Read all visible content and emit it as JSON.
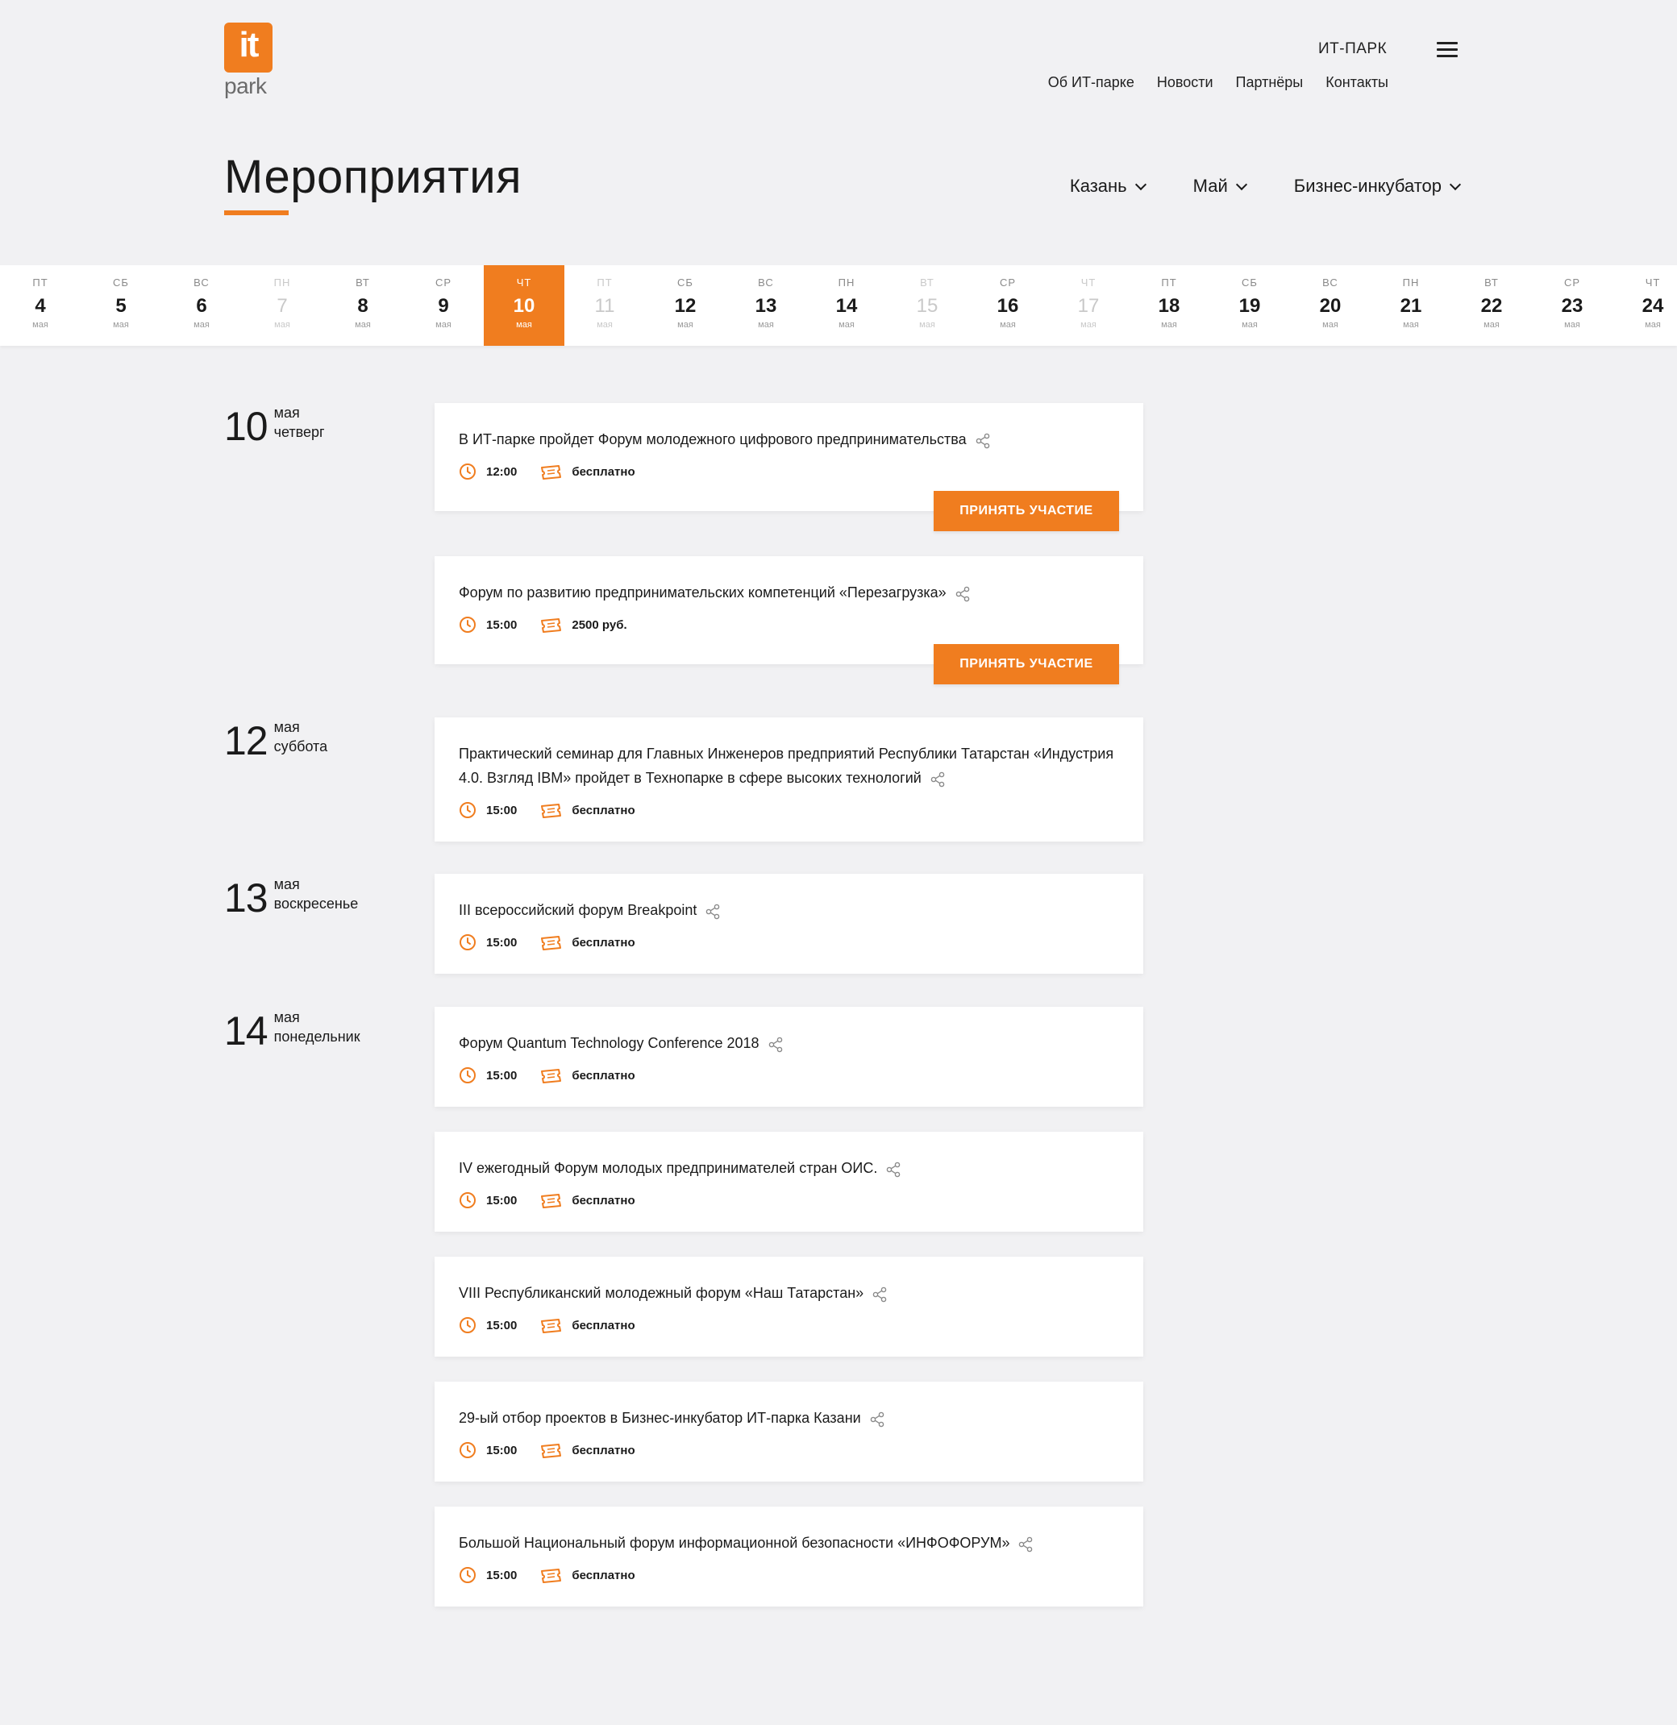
{
  "logo": {
    "mark": "it",
    "sub": "park"
  },
  "brand": "ИТ-ПАРК",
  "nav": [
    "Об ИТ-парке",
    "Новости",
    "Партнёры",
    "Контакты"
  ],
  "page_title": "Мероприятия",
  "filters": {
    "city": "Казань",
    "month": "Май",
    "category": "Бизнес-инкубатор"
  },
  "calendar": [
    {
      "dw": "пт",
      "dn": "4",
      "dm": "мая",
      "muted": false
    },
    {
      "dw": "сб",
      "dn": "5",
      "dm": "мая",
      "muted": false
    },
    {
      "dw": "вс",
      "dn": "6",
      "dm": "мая",
      "muted": false
    },
    {
      "dw": "пн",
      "dn": "7",
      "dm": "мая",
      "muted": true
    },
    {
      "dw": "вт",
      "dn": "8",
      "dm": "мая",
      "muted": false
    },
    {
      "dw": "ср",
      "dn": "9",
      "dm": "мая",
      "muted": false
    },
    {
      "dw": "чт",
      "dn": "10",
      "dm": "мая",
      "muted": false,
      "active": true
    },
    {
      "dw": "пт",
      "dn": "11",
      "dm": "мая",
      "muted": true
    },
    {
      "dw": "сб",
      "dn": "12",
      "dm": "мая",
      "muted": false
    },
    {
      "dw": "вс",
      "dn": "13",
      "dm": "мая",
      "muted": false
    },
    {
      "dw": "пн",
      "dn": "14",
      "dm": "мая",
      "muted": false
    },
    {
      "dw": "вт",
      "dn": "15",
      "dm": "мая",
      "muted": true
    },
    {
      "dw": "ср",
      "dn": "16",
      "dm": "мая",
      "muted": false
    },
    {
      "dw": "чт",
      "dn": "17",
      "dm": "мая",
      "muted": true
    },
    {
      "dw": "пт",
      "dn": "18",
      "dm": "мая",
      "muted": false
    },
    {
      "dw": "сб",
      "dn": "19",
      "dm": "мая",
      "muted": false
    },
    {
      "dw": "вс",
      "dn": "20",
      "dm": "мая",
      "muted": false
    },
    {
      "dw": "пн",
      "dn": "21",
      "dm": "мая",
      "muted": false
    },
    {
      "dw": "вт",
      "dn": "22",
      "dm": "мая",
      "muted": false
    },
    {
      "dw": "ср",
      "dn": "23",
      "dm": "мая",
      "muted": false
    },
    {
      "dw": "чт",
      "dn": "24",
      "dm": "мая",
      "muted": false
    }
  ],
  "date_labels": [
    {
      "num": "10",
      "month": "мая",
      "weekday": "четверг"
    },
    {
      "num": "12",
      "month": "мая",
      "weekday": "суббота"
    },
    {
      "num": "13",
      "month": "мая",
      "weekday": "воскресенье"
    },
    {
      "num": "14",
      "month": "мая",
      "weekday": "понедельник"
    }
  ],
  "join_label": "ПРИНЯТЬ УЧАСТИЕ",
  "events": [
    {
      "title": "В ИТ-парке пройдет Форум молодежного цифрового предпринимательства",
      "time": "12:00",
      "price": "бесплатно",
      "join": true
    },
    {
      "title": "Форум по развитию предпринимательских компетенций «Перезагрузка»",
      "time": "15:00",
      "price": "2500 руб.",
      "join": true
    },
    {
      "title": "Практический семинар для Главных Инженеров предприятий Республики Татарстан «Индустрия 4.0. Взгляд IBM» пройдет в Технопарке в сфере высоких технологий",
      "time": "15:00",
      "price": "бесплатно",
      "join": false
    },
    {
      "title": "III всероссийский форум Breakpoint",
      "time": "15:00",
      "price": "бесплатно",
      "join": false
    },
    {
      "title": "Форум Quantum Technology Conference 2018",
      "time": "15:00",
      "price": "бесплатно",
      "join": false
    },
    {
      "title": "IV ежегодный Форум молодых предпринимателей стран ОИС.",
      "time": "15:00",
      "price": "бесплатно",
      "join": false
    },
    {
      "title": "VIII Республиканский молодежный форум «Наш Татарстан»",
      "time": "15:00",
      "price": "бесплатно",
      "join": false
    },
    {
      "title": "29-ый отбор проектов в Бизнес-инкубатор ИТ-парка Казани",
      "time": "15:00",
      "price": "бесплатно",
      "join": false
    },
    {
      "title": "Большой Национальный форум информационной безопасности «ИНФОФОРУМ»",
      "time": "15:00",
      "price": "бесплатно",
      "join": false
    }
  ],
  "colors": {
    "accent": "#f07d1f",
    "background": "#f1f1f3"
  },
  "icons": {
    "clock": "clock-icon",
    "ticket": "ticket-icon",
    "share": "share-icon",
    "menu": "hamburger-icon"
  }
}
